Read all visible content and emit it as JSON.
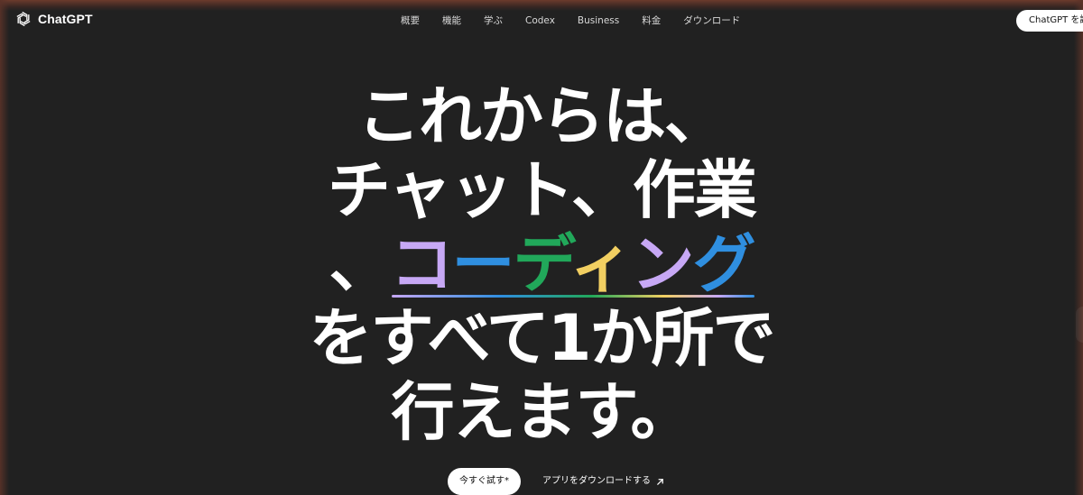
{
  "header": {
    "logo_text": "ChatGPT",
    "nav": [
      "概要",
      "機能",
      "学ぶ",
      "Codex",
      "Business",
      "料金",
      "ダウンロード"
    ],
    "cta_label": "ChatGPT を試す"
  },
  "hero": {
    "line1": "これからは、",
    "line2": "チャット、作業",
    "line3_prefix": "、",
    "coding_chars": [
      "コ",
      "ー",
      "デ",
      "ィ",
      "ン",
      "グ"
    ],
    "line4": "をすべて1か所で",
    "line5": "行えます。"
  },
  "actions": {
    "try_label": "今すぐ試す*",
    "download_label": "アプリをダウンロードする"
  },
  "colors": {
    "background": "#212121",
    "accent_purple": "#c7a8f5",
    "accent_blue": "#2f8fe0",
    "accent_green": "#21a85a",
    "accent_yellow": "#f2cf61"
  },
  "icons": {
    "logo": "openai-logo-icon",
    "external": "arrow-up-right-icon"
  }
}
